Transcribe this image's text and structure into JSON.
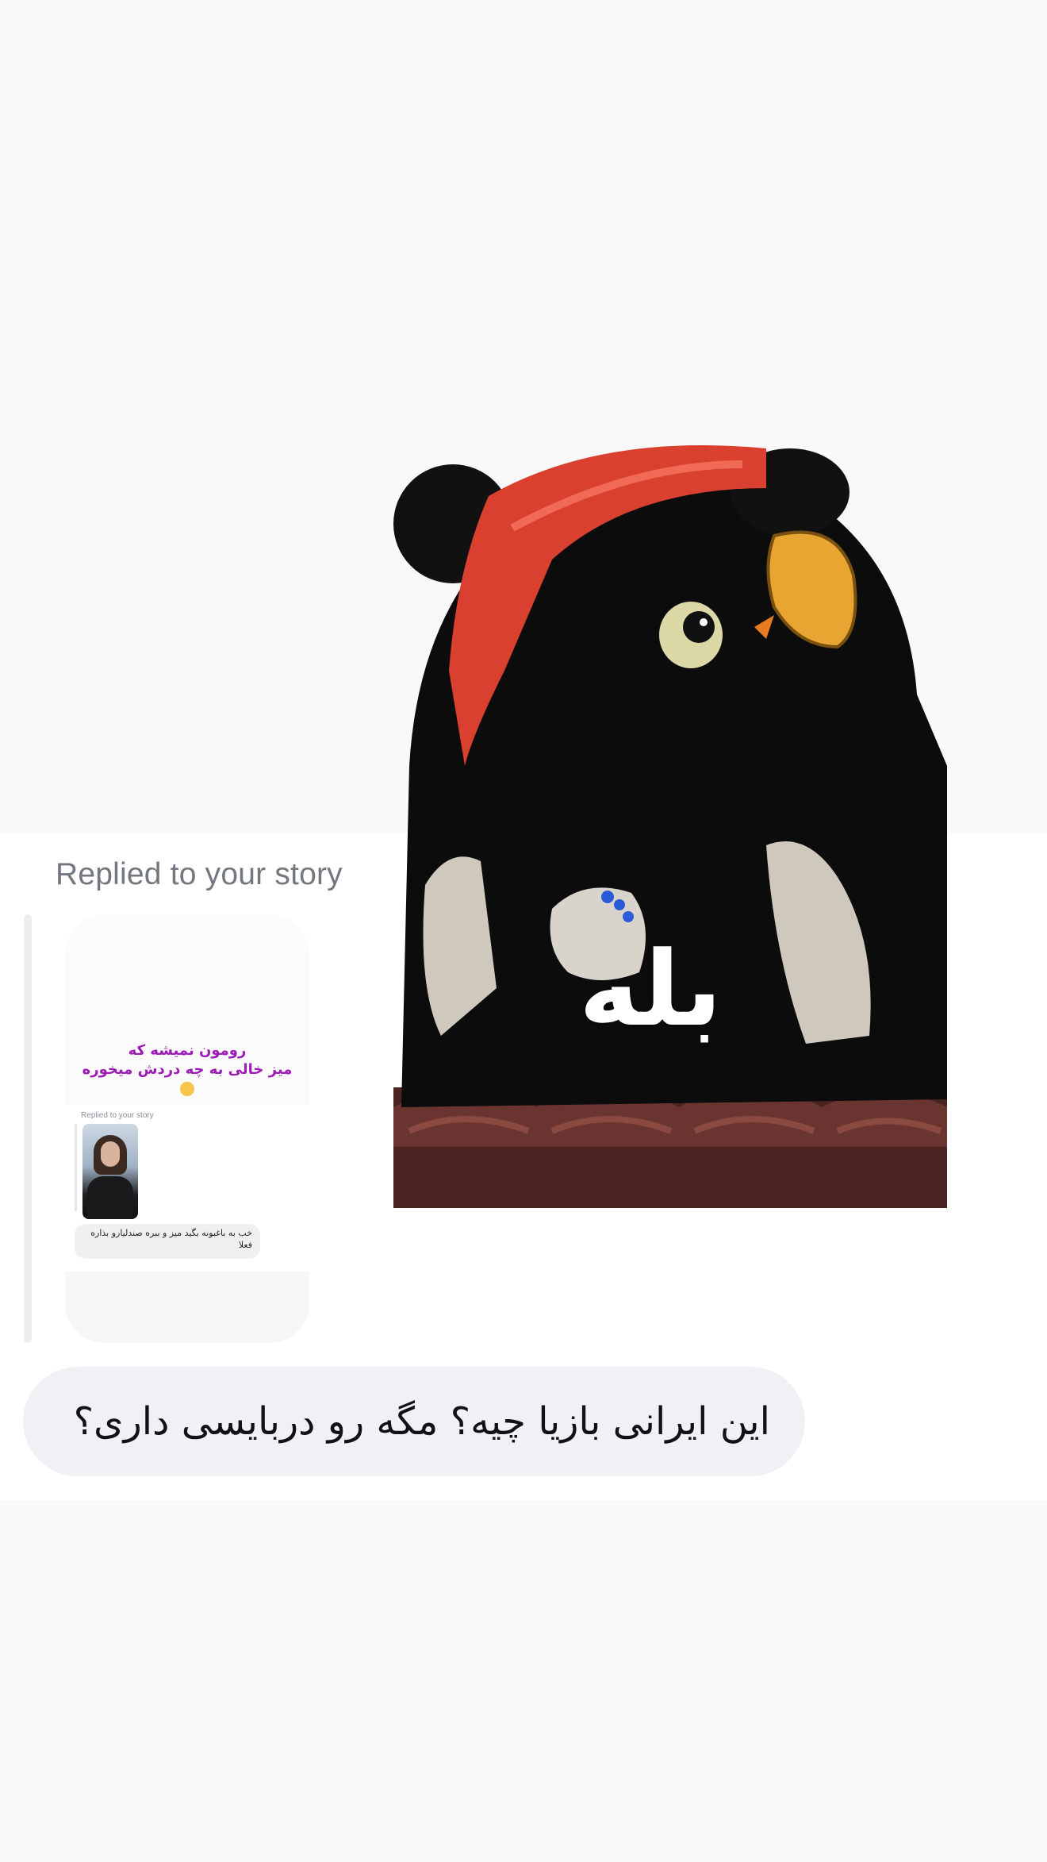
{
  "conversation": {
    "replied_label": "Replied to your story",
    "story_card": {
      "caption_line1": "رومون نمیشه که",
      "caption_line2": "میز خالی به چه دردش میخوره",
      "inner_replied_label": "Replied to your story",
      "inner_message": "خب به باغبونه بگید میز و ببره صندلیارو بذاره فعلا"
    },
    "sticker": {
      "text": "بله",
      "icon": "pirate-owl-sticker"
    },
    "message": "این ایرانی بازیا چیه؟ مگه رو دربایسی داری؟"
  },
  "colors": {
    "caption_purple": "#9d1cb7",
    "bubble_grey": "#f0f1f4",
    "label_grey": "#737780"
  }
}
